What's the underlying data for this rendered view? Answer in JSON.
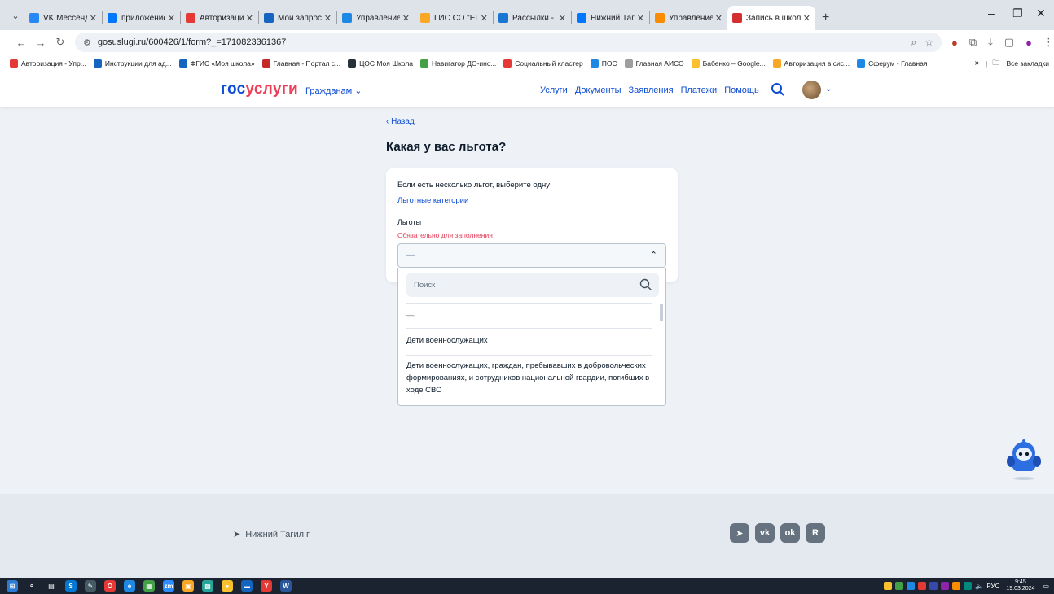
{
  "browser": {
    "tabs": [
      {
        "title": "VK Мессенджер",
        "icon_color": "#2787f5"
      },
      {
        "title": "приложение+МС",
        "icon_color": "#0077ff"
      },
      {
        "title": "Авторизация по",
        "icon_color": "#e53935"
      },
      {
        "title": "Мои запросы - Т",
        "icon_color": "#1565c0"
      },
      {
        "title": "Управление Обр",
        "icon_color": "#1e88e5"
      },
      {
        "title": "ГИС СО \"ЕЦП\"",
        "icon_color": "#f9a825"
      },
      {
        "title": "Рассылки - Почта",
        "icon_color": "#1976d2"
      },
      {
        "title": "Нижний Тагил",
        "icon_color": "#0077ff"
      },
      {
        "title": "Управление обр",
        "icon_color": "#fb8c00"
      }
    ],
    "active_tab": {
      "title": "Запись в школу |",
      "icon_color": "#d32f2f"
    },
    "url": "gosuslugi.ru/600426/1/form?_=1710823361367",
    "bookmarks": [
      {
        "label": "Авторизация - Упр...",
        "color": "#e53935"
      },
      {
        "label": "Инструкции для ад...",
        "color": "#1565c0"
      },
      {
        "label": "ФГИС «Моя школа»",
        "color": "#1565c0"
      },
      {
        "label": "Главная - Портал с...",
        "color": "#c62828"
      },
      {
        "label": "ЦОС Моя Школа",
        "color": "#263238"
      },
      {
        "label": "Навигатор ДО-инс...",
        "color": "#43a047"
      },
      {
        "label": "Социальный кластер",
        "color": "#e53935"
      },
      {
        "label": "ПОС",
        "color": "#1e88e5"
      },
      {
        "label": "Главная АИСО",
        "color": "#9e9e9e"
      },
      {
        "label": "Бабенко – Google...",
        "color": "#fbc02d"
      },
      {
        "label": "Авторизация в сис...",
        "color": "#f9a825"
      },
      {
        "label": "Сферум - Главная",
        "color": "#1e88e5"
      }
    ],
    "all_bookmarks": "Все закладки"
  },
  "header": {
    "logo_part1": "гос",
    "logo_part2": "услуги",
    "citizens": "Гражданам",
    "nav": [
      "Услуги",
      "Документы",
      "Заявления",
      "Платежи",
      "Помощь"
    ]
  },
  "form": {
    "back": "‹ Назад",
    "title": "Какая у вас льгота?",
    "hint": "Если есть несколько льгот, выберите одну",
    "categories_link": "Льготные категории",
    "field_label": "Льготы",
    "required": "Обязательно для заполнения",
    "selected_value": "—",
    "search_placeholder": "Поиск",
    "options": [
      "—",
      "Дети военнослужащих",
      "Дети военнослужащих, граждан, пребывавших в добровольческих формированиях, и сотрудников национальной гвардии, погибших в ходе СВО"
    ]
  },
  "footer": {
    "location": "Нижний Тагил г",
    "socials": [
      "telegram",
      "vk",
      "odnoklassniki",
      "rutube"
    ]
  },
  "taskbar": {
    "lang": "РУС",
    "time": "9:45",
    "date": "19.03.2024"
  }
}
